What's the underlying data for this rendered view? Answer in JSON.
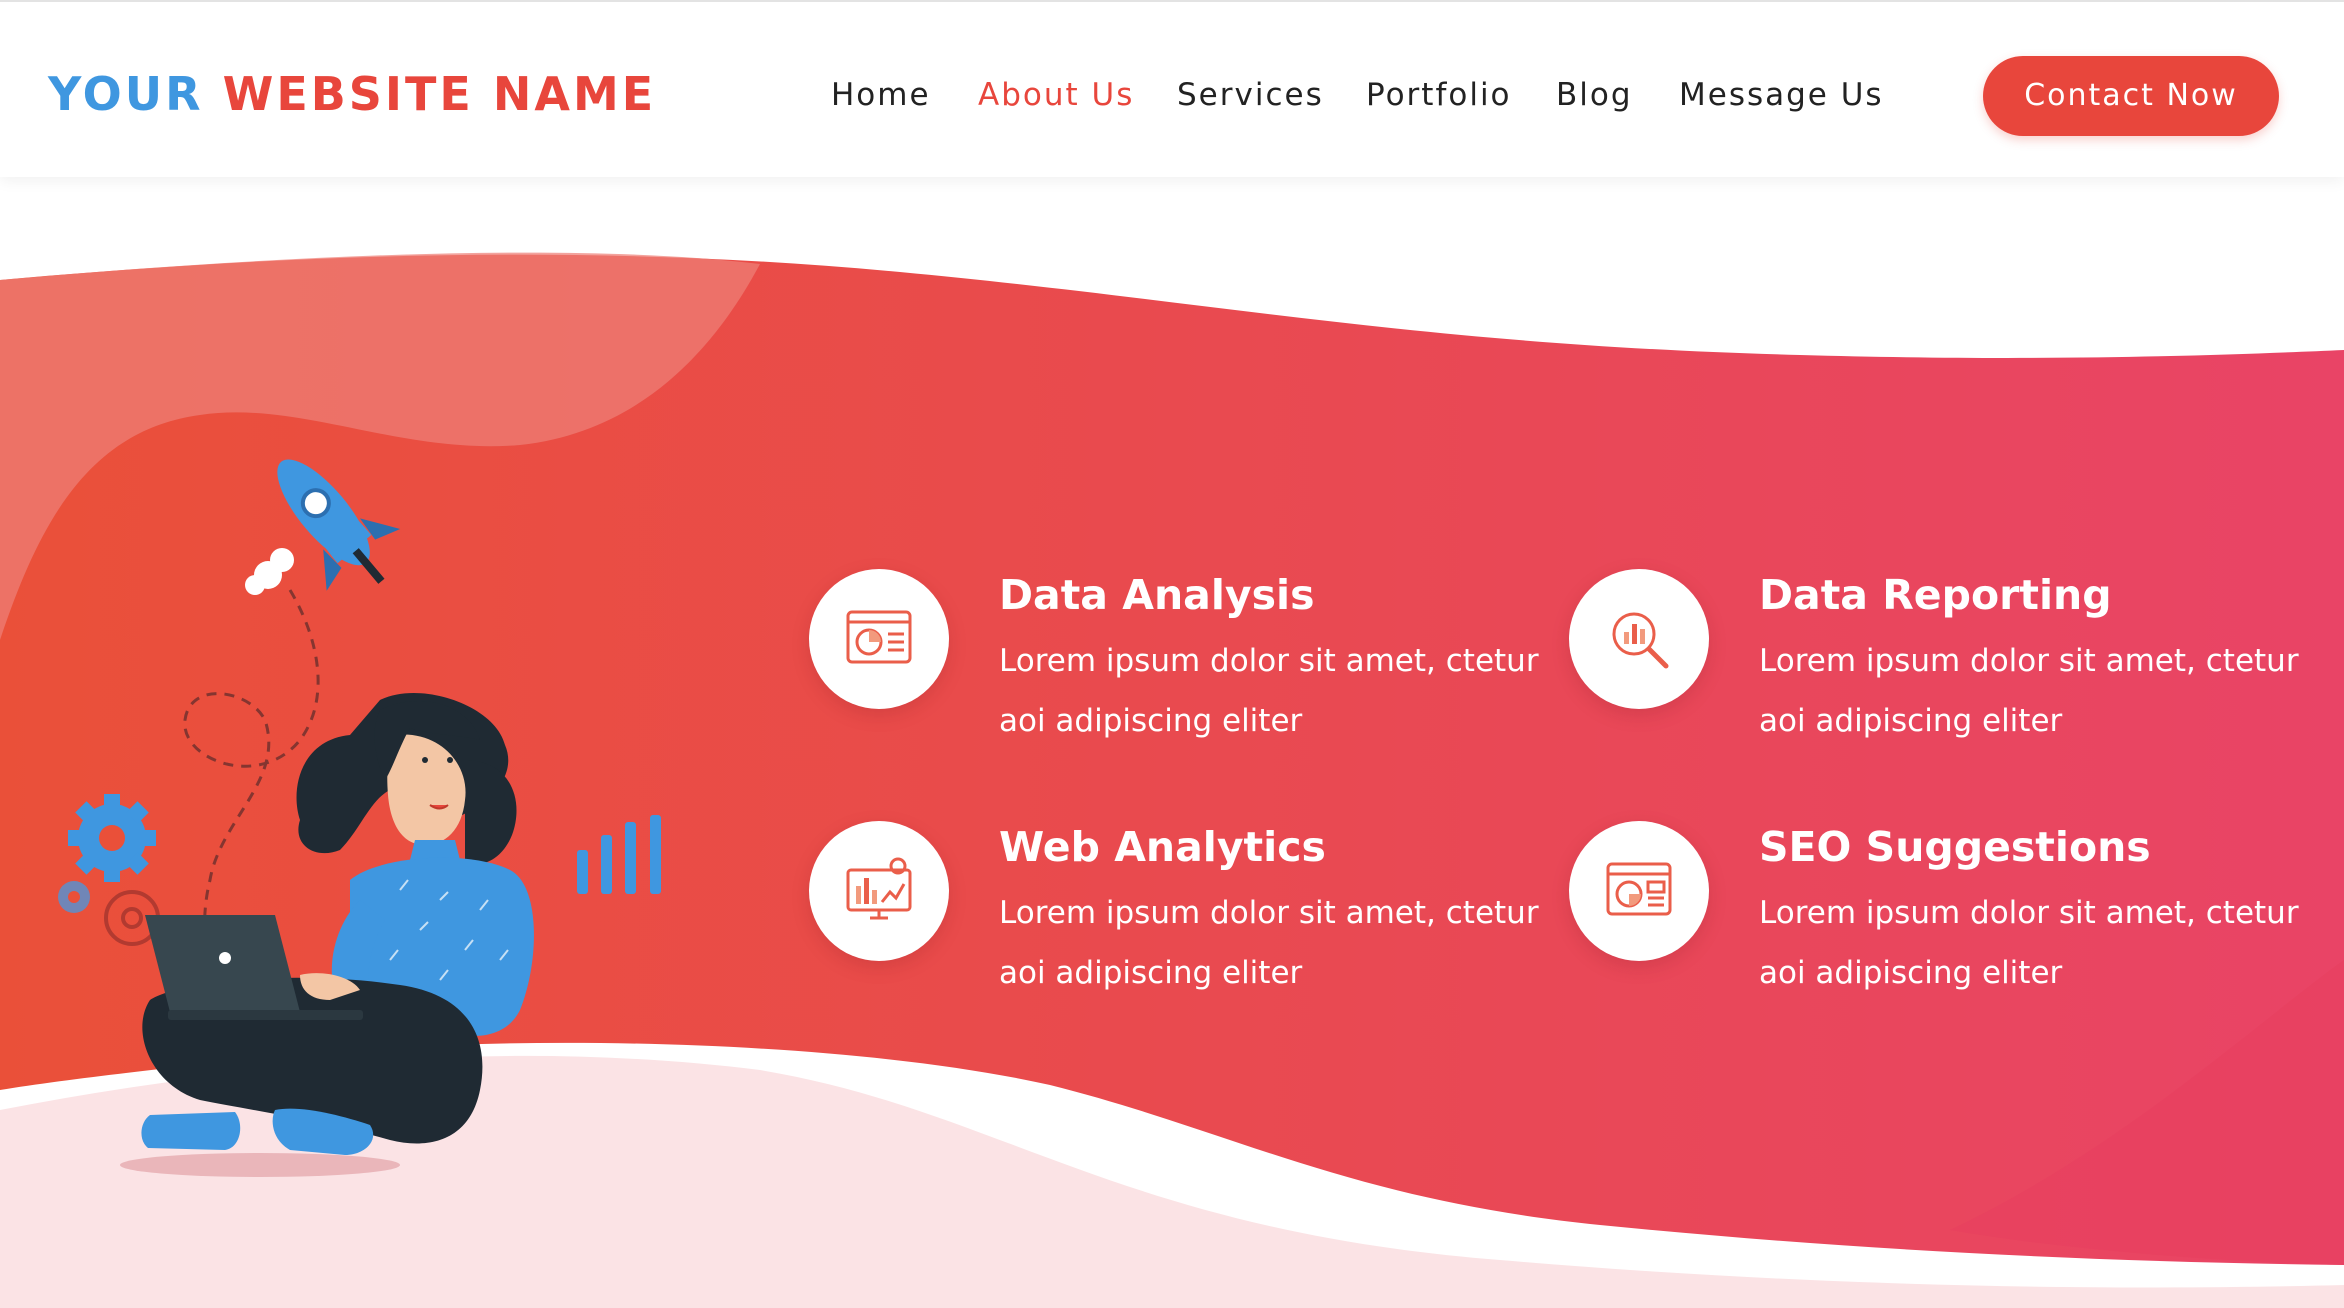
{
  "brand": {
    "part1": "YOUR",
    "part2": "WEBSITE NAME",
    "color_primary": "#3f97e0",
    "color_accent": "#e8463c"
  },
  "nav": {
    "items": [
      {
        "label": "Home",
        "active": false
      },
      {
        "label": "About Us",
        "active": true
      },
      {
        "label": "Services",
        "active": false
      },
      {
        "label": "Portfolio",
        "active": false
      },
      {
        "label": "Blog",
        "active": false
      },
      {
        "label": "Message Us",
        "active": false
      }
    ],
    "cta_label": "Contact Now"
  },
  "hero": {
    "gradient_start": "#e94f3d",
    "gradient_end": "#e94466",
    "illustration_icons": [
      "rocket-icon",
      "gear-icon",
      "bar-chart-icon",
      "laptop-icon"
    ]
  },
  "features": [
    {
      "title": "Data Analysis",
      "line1": "Lorem ipsum dolor sit amet, ctetur",
      "line2": "aoi adipiscing eliter",
      "icon": "pie-chart-monitor-icon"
    },
    {
      "title": "Data Reporting",
      "line1": "Lorem ipsum dolor sit amet, ctetur",
      "line2": "aoi adipiscing eliter",
      "icon": "magnifier-chart-icon"
    },
    {
      "title": "Web Analytics",
      "line1": "Lorem ipsum dolor sit amet, ctetur",
      "line2": "aoi adipiscing eliter",
      "icon": "analytics-monitor-icon"
    },
    {
      "title": "SEO Suggestions",
      "line1": "Lorem ipsum dolor sit amet, ctetur",
      "line2": "aoi adipiscing eliter",
      "icon": "seo-chart-icon"
    }
  ]
}
